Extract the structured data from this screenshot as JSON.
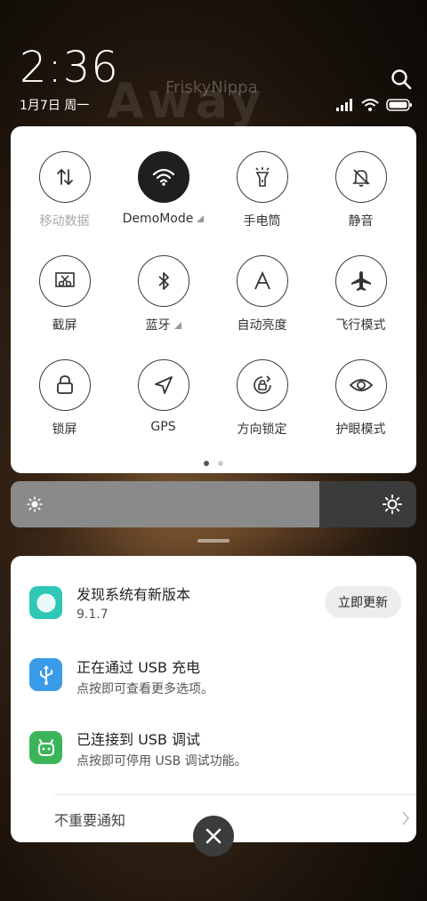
{
  "status": {
    "time": "2:36",
    "date": "1月7日 周一"
  },
  "wallpaper": {
    "word": "Away",
    "sub": "FriskyNippa"
  },
  "quick_settings": [
    {
      "label": "移动数据",
      "active": false,
      "dim": true,
      "icon": "mobile-data-icon"
    },
    {
      "label": "DemoMode",
      "active": true,
      "dim": false,
      "icon": "wifi-icon",
      "expand": true
    },
    {
      "label": "手电筒",
      "active": false,
      "dim": false,
      "icon": "flashlight-icon"
    },
    {
      "label": "静音",
      "active": false,
      "dim": false,
      "icon": "bell-mute-icon"
    },
    {
      "label": "截屏",
      "active": false,
      "dim": false,
      "icon": "screenshot-icon"
    },
    {
      "label": "蓝牙",
      "active": false,
      "dim": false,
      "icon": "bluetooth-icon",
      "expand": true
    },
    {
      "label": "自动亮度",
      "active": false,
      "dim": false,
      "icon": "auto-brightness-icon"
    },
    {
      "label": "飞行模式",
      "active": false,
      "dim": false,
      "icon": "airplane-icon"
    },
    {
      "label": "锁屏",
      "active": false,
      "dim": false,
      "icon": "lock-icon"
    },
    {
      "label": "GPS",
      "active": false,
      "dim": false,
      "icon": "gps-icon"
    },
    {
      "label": "方向锁定",
      "active": false,
      "dim": false,
      "icon": "rotation-lock-icon"
    },
    {
      "label": "护眼模式",
      "active": false,
      "dim": false,
      "icon": "eye-icon"
    }
  ],
  "brightness": {
    "level": 0.76
  },
  "notifications": [
    {
      "title": "发现系统有新版本",
      "subtitle": "9.1.7",
      "button": "立即更新",
      "icon": "updater-icon",
      "color": "#2fc7b6"
    },
    {
      "title": "正在通过 USB 充电",
      "subtitle": "点按即可查看更多选项。",
      "icon": "usb-icon",
      "color": "#3a9be8"
    },
    {
      "title": "已连接到 USB 调试",
      "subtitle": "点按即可停用 USB 调试功能。",
      "icon": "android-icon",
      "color": "#3cb55a"
    }
  ],
  "minor_notifications": "不重要通知"
}
